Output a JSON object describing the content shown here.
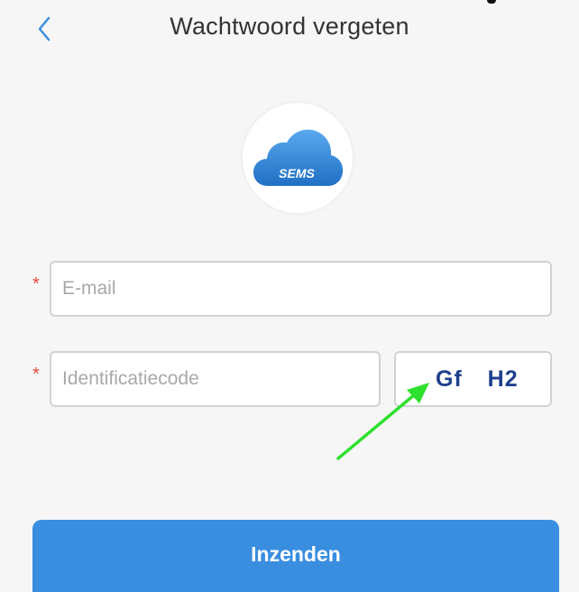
{
  "header": {
    "title": "Wachtwoord vergeten",
    "back_icon": "chevron-left-icon"
  },
  "logo": {
    "text": "SEMS",
    "icon": "cloud-icon",
    "colors": {
      "cloud": "#2f86d6",
      "text": "#ffffff"
    }
  },
  "form": {
    "email": {
      "placeholder": "E-mail",
      "value": "",
      "required": true
    },
    "code": {
      "placeholder": "Identificatiecode",
      "value": "",
      "required": true
    },
    "captcha": {
      "text": "Gf  H2"
    },
    "required_marker": "*",
    "submit_label": "Inzenden"
  },
  "colors": {
    "accent": "#3a8ee0",
    "background": "#f6f6f6",
    "required": "#e04a3a",
    "annotation_arrow": "#2ee02e"
  }
}
